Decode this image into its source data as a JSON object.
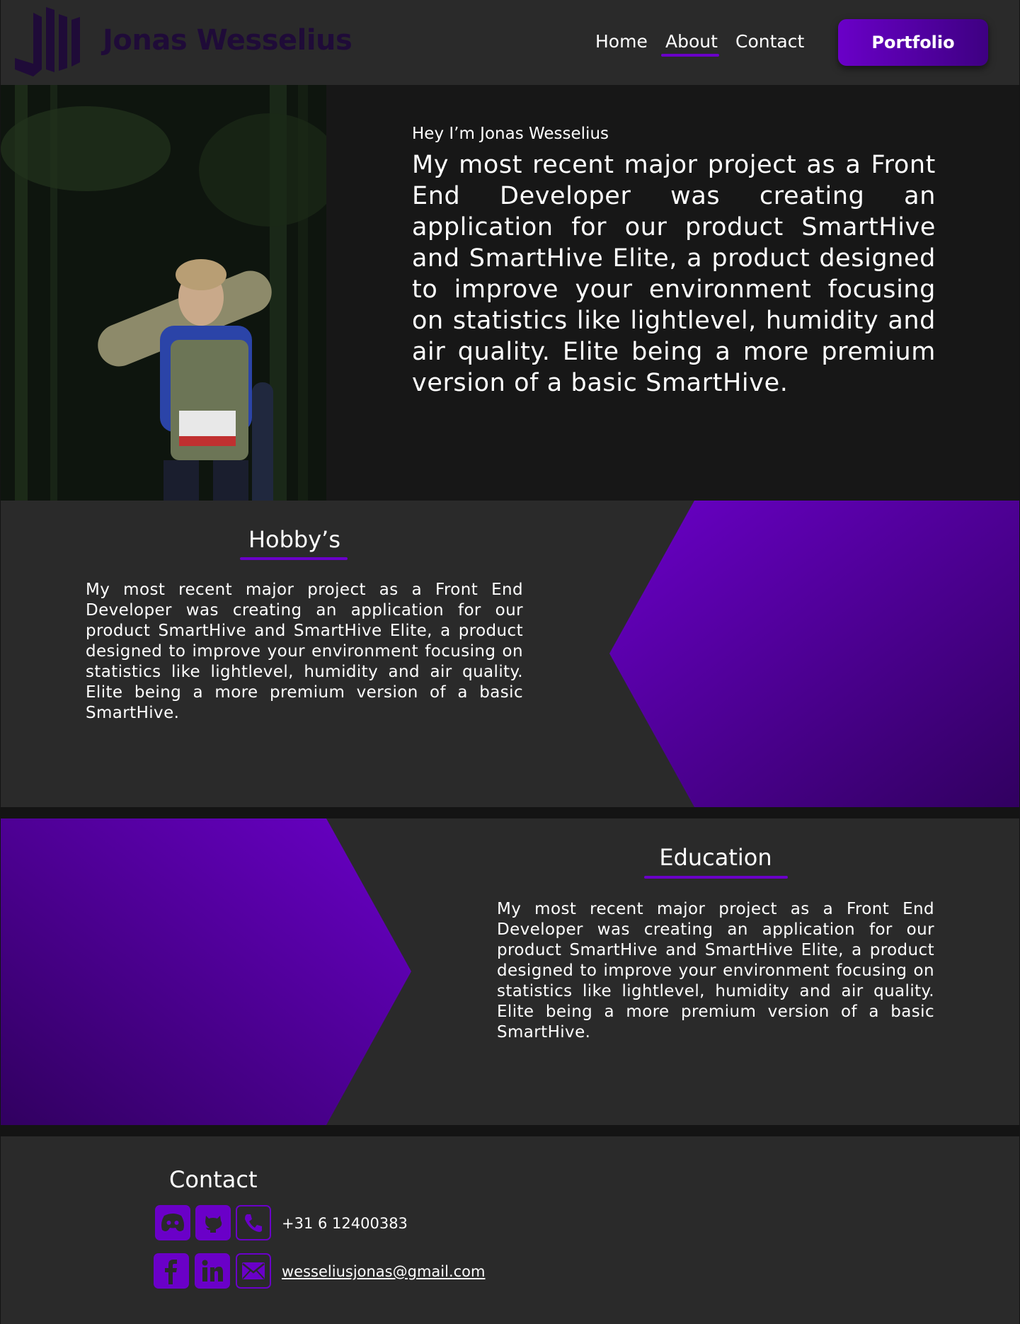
{
  "header": {
    "brand": "Jonas Wesselius",
    "nav": [
      {
        "label": "Home"
      },
      {
        "label": "About",
        "active": true
      },
      {
        "label": "Contact"
      }
    ],
    "cta_label": "Portfolio",
    "logo_icon": "jw-monogram-icon"
  },
  "hero": {
    "intro": "Hey I’m Jonas Wesselius",
    "text": "My most recent major project as a Front End Developer was creating an application for our product SmartHive and SmartHive Elite, a product designed to improve your environment focusing on statistics like lightlevel, humidity and air quality. Elite being a more premium version of a basic SmartHive.",
    "photo_icon": "portrait-photo"
  },
  "hobbies": {
    "title": "Hobby’s",
    "text": "My most recent major project as a Front End Developer was creating an application for our product SmartHive and SmartHive Elite, a product designed to improve your environment focusing on statistics like lightlevel, humidity and air quality. Elite being a more premium version of a basic SmartHive."
  },
  "education": {
    "title": "Education",
    "text": "My most recent major project as a Front End Developer was creating an application for our product SmartHive and SmartHive Elite, a product designed to improve your environment focusing on statistics like lightlevel, humidity and air quality. Elite being a more premium version of a basic SmartHive."
  },
  "contact": {
    "title": "Contact",
    "phone": "+31 6 12400383",
    "email": "wesseliusjonas@gmail.com",
    "icons": [
      "discord-icon",
      "github-icon",
      "phone-icon",
      "facebook-icon",
      "linkedin-icon",
      "mail-icon"
    ]
  },
  "colors": {
    "accent": "#6a00c8",
    "accent_dark": "#3e0082",
    "panel": "#2a2a2a",
    "background": "#171717",
    "brand_text": "#1f0b38"
  }
}
